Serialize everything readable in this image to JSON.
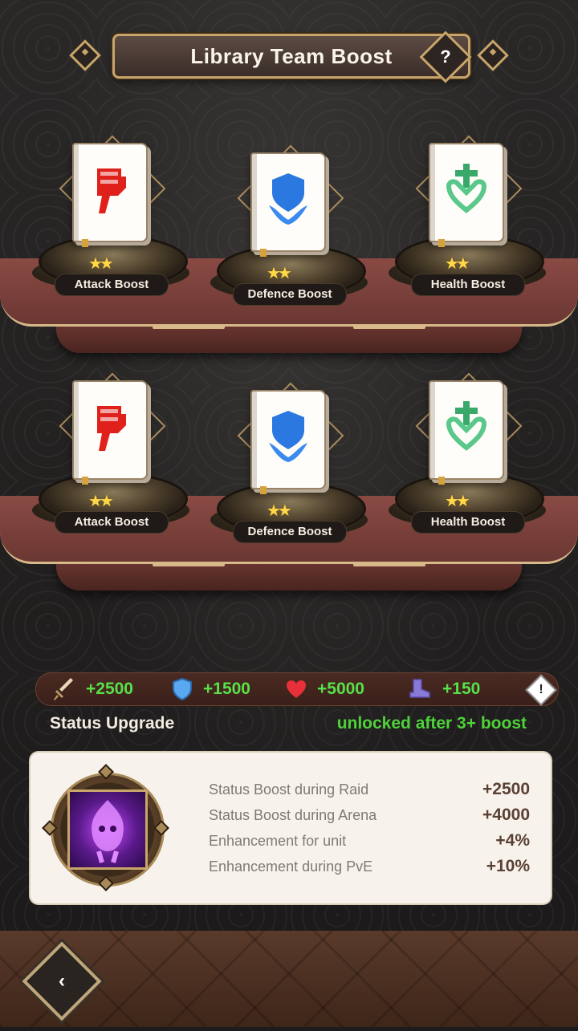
{
  "header": {
    "title": "Library Team Boost",
    "help_label": "?"
  },
  "shelves": [
    {
      "items": [
        {
          "label": "Attack Boost",
          "stars": "★★",
          "icon": "fist-icon"
        },
        {
          "label": "Defence Boost",
          "stars": "★★",
          "icon": "shield-icon"
        },
        {
          "label": "Health Boost",
          "stars": "★★",
          "icon": "cross-heart-icon"
        }
      ]
    },
    {
      "items": [
        {
          "label": "Attack Boost",
          "stars": "★★",
          "icon": "fist-icon"
        },
        {
          "label": "Defence Boost",
          "stars": "★★",
          "icon": "shield-icon"
        },
        {
          "label": "Health Boost",
          "stars": "★★",
          "icon": "cross-heart-icon"
        }
      ]
    }
  ],
  "stats": [
    {
      "icon": "sword-icon",
      "value": "+2500"
    },
    {
      "icon": "shield-icon",
      "value": "+1500"
    },
    {
      "icon": "heart-icon",
      "value": "+5000"
    },
    {
      "icon": "boot-icon",
      "value": "+150"
    }
  ],
  "warning_label": "!",
  "status": {
    "title": "Status Upgrade",
    "note": "unlocked after 3+ boost",
    "rows": [
      {
        "label": "Status Boost during Raid",
        "value": "+2500"
      },
      {
        "label": "Status Boost during Arena",
        "value": "+4000"
      },
      {
        "label": "Enhancement for unit",
        "value": "+4%"
      },
      {
        "label": "Enhancement during PvE",
        "value": "+10%"
      }
    ]
  },
  "colors": {
    "accent_gold": "#c8a56a",
    "stat_green": "#58e04a",
    "note_green": "#4ed23a"
  }
}
